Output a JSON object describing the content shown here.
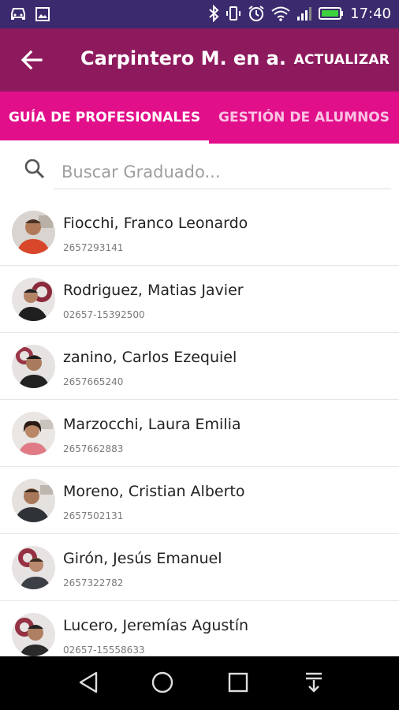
{
  "status_bar": {
    "time": "17:40",
    "left_icons": [
      "car-icon",
      "image-icon"
    ],
    "right_icons": [
      "bluetooth-icon",
      "vibrate-icon",
      "alarm-icon",
      "wifi-icon",
      "signal-icon",
      "battery-icon"
    ]
  },
  "app_bar": {
    "title": "Carpintero M. en a...",
    "action_label": "ACTUALIZAR"
  },
  "tabs": [
    {
      "label": "GUÍA DE PROFESIONALES",
      "selected": true
    },
    {
      "label": "GESTIÓN DE ALUMNOS",
      "selected": false
    }
  ],
  "search": {
    "placeholder": "Buscar Graduado...",
    "value": ""
  },
  "graduates": [
    {
      "name": "Fiocchi, Franco Leonardo",
      "phone": "2657293141"
    },
    {
      "name": "Rodriguez, Matias Javier",
      "phone": "02657-15392500"
    },
    {
      "name": "zanino, Carlos Ezequiel",
      "phone": "2657665240"
    },
    {
      "name": "Marzocchi, Laura Emilia",
      "phone": "2657662883"
    },
    {
      "name": "Moreno, Cristian Alberto",
      "phone": "2657502131"
    },
    {
      "name": "Girón, Jesús Emanuel",
      "phone": "2657322782"
    },
    {
      "name": "Lucero, Jeremías Agustín",
      "phone": "02657-15558633"
    }
  ],
  "colors": {
    "status_bar": "#3b2b6e",
    "app_bar": "#8e1a5e",
    "tab_bar": "#e20f8a",
    "nav_bar": "#000000"
  }
}
